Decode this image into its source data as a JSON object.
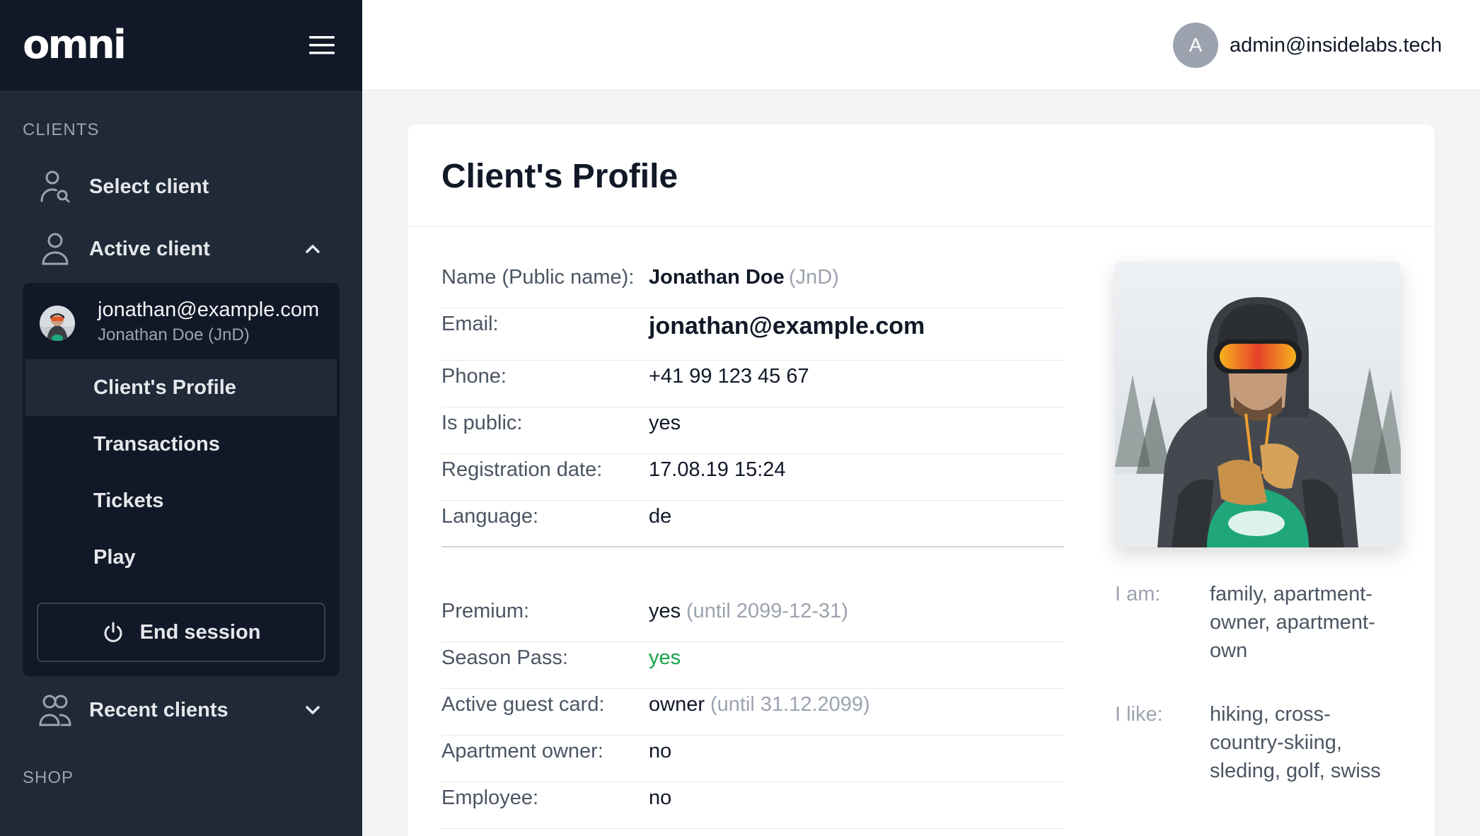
{
  "app": {
    "logo": "omni"
  },
  "sidebar": {
    "clients_section": "CLIENTS",
    "select_client": "Select client",
    "active_client": "Active client",
    "active": {
      "email": "jonathan@example.com",
      "name": "Jonathan Doe (JnD)",
      "items": [
        {
          "label": "Client's Profile",
          "selected": true
        },
        {
          "label": "Transactions",
          "selected": false
        },
        {
          "label": "Tickets",
          "selected": false
        },
        {
          "label": "Play",
          "selected": false
        }
      ],
      "end_session": "End session"
    },
    "recent_clients": "Recent clients",
    "shop_section": "SHOP"
  },
  "topbar": {
    "avatar_letter": "A",
    "user_email": "admin@insidelabs.tech"
  },
  "profile": {
    "title": "Client's Profile",
    "rows_top": [
      {
        "label": "Name (Public name):",
        "value": "Jonathan Doe",
        "extra": "(JnD)"
      },
      {
        "label": "Email:",
        "value": "jonathan@example.com"
      },
      {
        "label": "Phone:",
        "value": "+41 99 123 45 67"
      },
      {
        "label": "Is public:",
        "value": "yes"
      },
      {
        "label": "Registration date:",
        "value": "17.08.19 15:24"
      },
      {
        "label": "Language:",
        "value": "de"
      }
    ],
    "rows_bottom": [
      {
        "label": "Premium:",
        "value": "yes",
        "extra": "(until 2099-12-31)"
      },
      {
        "label": "Season Pass:",
        "value": "yes"
      },
      {
        "label": "Active guest card:",
        "value": "owner",
        "extra": "(until 31.12.2099)"
      },
      {
        "label": "Apartment owner:",
        "value": "no"
      },
      {
        "label": "Employee:",
        "value": "no"
      }
    ],
    "i_am_label": "I am:",
    "i_am_value": "family, apartment-owner, apartment-own",
    "i_like_label": "I like:",
    "i_like_value": "hiking, cross-country-skiing, sleding, golf, swiss"
  },
  "colors": {
    "sidebar_bg": "#1f2937",
    "sidebar_dark": "#111827",
    "success": "#16a34a"
  }
}
